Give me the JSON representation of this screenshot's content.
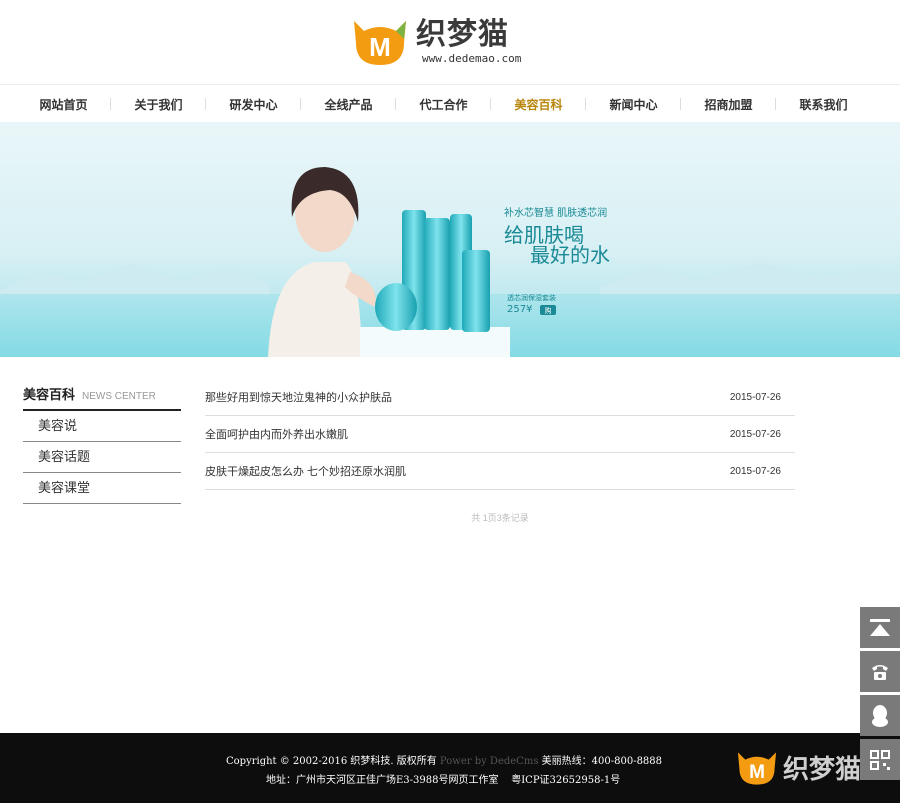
{
  "logo": {
    "cn": "织梦猫",
    "url": "www.dedemao.com",
    "mark_letter": "M"
  },
  "nav": {
    "items": [
      {
        "label": "网站首页"
      },
      {
        "label": "关于我们"
      },
      {
        "label": "研发中心"
      },
      {
        "label": "全线产品"
      },
      {
        "label": "代工合作"
      },
      {
        "label": "美容百科"
      },
      {
        "label": "新闻中心"
      },
      {
        "label": "招商加盟"
      },
      {
        "label": "联系我们"
      }
    ],
    "active_index": 5
  },
  "banner": {
    "tagline": "补水芯智慧 肌肤透芯润",
    "slogan1": "给肌肤喝",
    "slogan2": "最好的水",
    "product": "透芯润保湿套装",
    "price": "257¥",
    "buy": "购"
  },
  "sidebar": {
    "title": "美容百科",
    "subtitle": "NEWS CENTER",
    "items": [
      {
        "label": "美容说"
      },
      {
        "label": "美容话题"
      },
      {
        "label": "美容课堂"
      }
    ]
  },
  "articles": [
    {
      "title": "那些好用到惊天地泣鬼神的小众护肤品",
      "date": "2015-07-26"
    },
    {
      "title": "全面呵护由内而外养出水嫩肌",
      "date": "2015-07-26"
    },
    {
      "title": "皮肤干燥起皮怎么办 七个妙招还原水润肌",
      "date": "2015-07-26"
    }
  ],
  "pager": {
    "text": "共 1页3条记录"
  },
  "footer": {
    "copyright": "Copyright © 2002-2016 织梦科技. 版权所有",
    "power": "Power by DedeCms",
    "hotline": "美丽热线：400-800-8888",
    "address": "地址：广州市天河区正佳广场E3-3988号网页工作室",
    "icp": "粤ICP证32652958-1号"
  },
  "colors": {
    "accent": "#b8860b",
    "footer_bg": "#0d0d0d",
    "tool_bg": "#7a7a7a",
    "logo_orange": "#f39c12"
  }
}
